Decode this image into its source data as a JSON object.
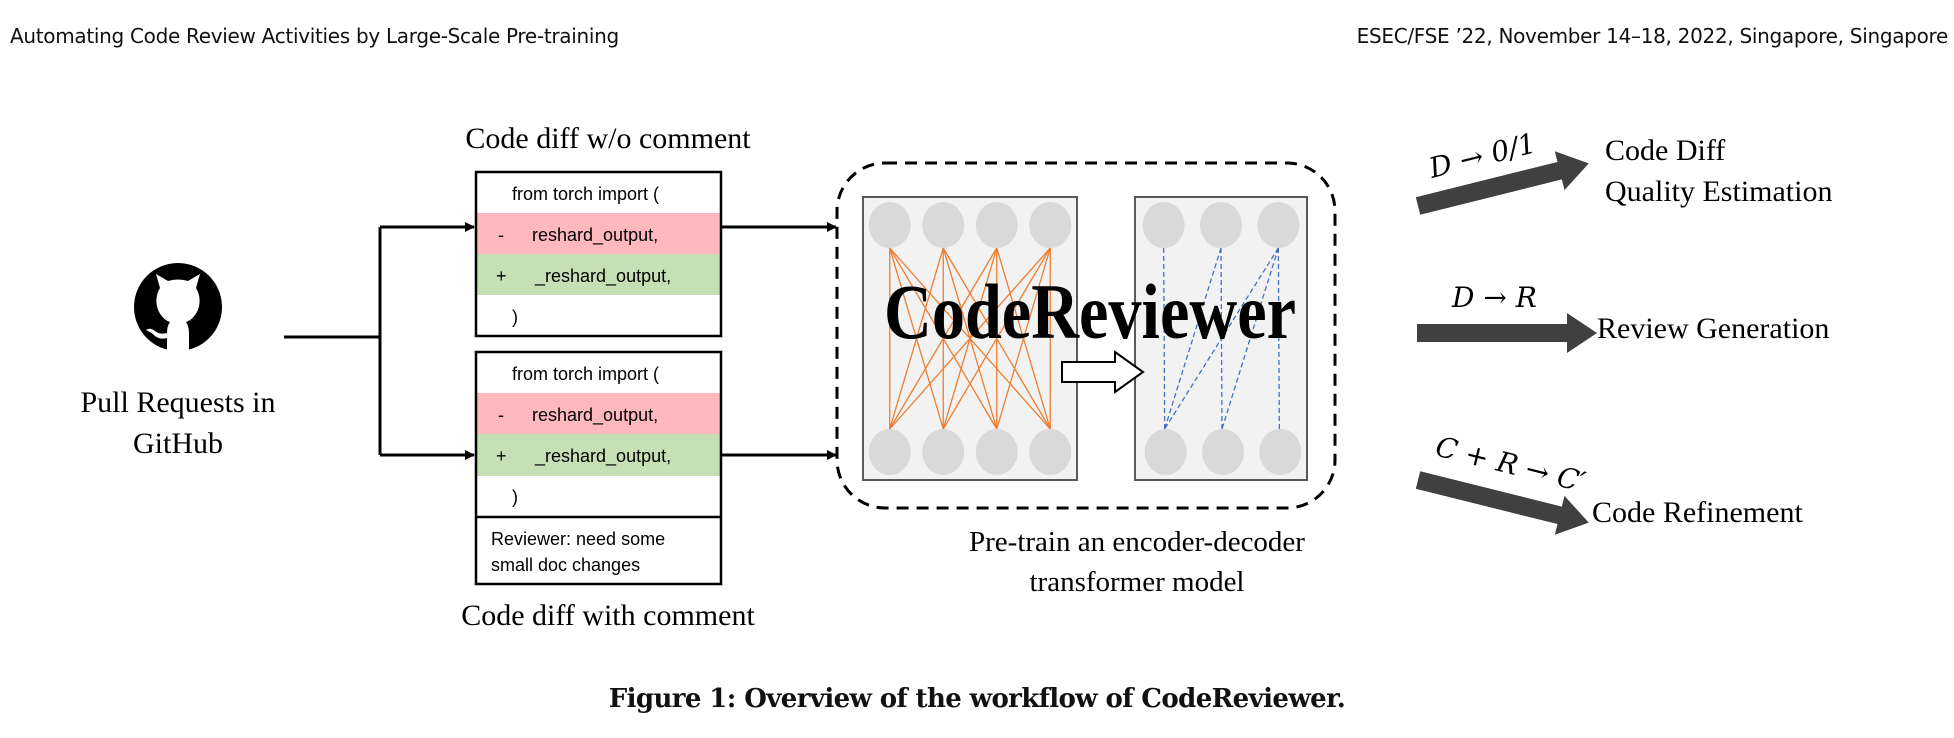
{
  "header": {
    "left": "Automating Code Review Activities by Large-Scale Pre-training",
    "right": "ESEC/FSE ’22, November 14–18, 2022, Singapore, Singapore"
  },
  "source": {
    "icon": "github-icon",
    "label_line1": "Pull Requests in",
    "label_line2": "GitHub"
  },
  "diff_without_comment": {
    "title": "Code diff w/o comment",
    "lines": [
      {
        "marker": "",
        "text": "from torch import (",
        "kind": "context"
      },
      {
        "marker": "-",
        "text": "reshard_output,",
        "kind": "removed"
      },
      {
        "marker": "+",
        "text": "_reshard_output,",
        "kind": "added"
      },
      {
        "marker": "",
        "text": ")",
        "kind": "context"
      }
    ]
  },
  "diff_with_comment": {
    "title": "Code diff with comment",
    "lines": [
      {
        "marker": "",
        "text": "from torch import (",
        "kind": "context"
      },
      {
        "marker": "-",
        "text": "reshard_output,",
        "kind": "removed"
      },
      {
        "marker": "+",
        "text": "_reshard_output,",
        "kind": "added"
      },
      {
        "marker": "",
        "text": ")",
        "kind": "context"
      }
    ],
    "comment_line1": "Reviewer: need some",
    "comment_line2": "small doc changes"
  },
  "model": {
    "name": "CodeReviewer",
    "caption_line1": "Pre-train an encoder-decoder",
    "caption_line2": "transformer model",
    "encoder_nodes_per_layer": 4,
    "decoder_nodes_per_layer": 3
  },
  "tasks": [
    {
      "formula": "D → 0/1",
      "label_line1": "Code Diff",
      "label_line2": "Quality Estimation"
    },
    {
      "formula": "D → R",
      "label_line1": "Review Generation",
      "label_line2": ""
    },
    {
      "formula": "C + R → C′",
      "label_line1": "Code Refinement",
      "label_line2": ""
    }
  ],
  "colors": {
    "removed": "#FFB9BE",
    "added": "#C5E0B4",
    "encoder_edge": "#ED7D31",
    "decoder_edge": "#4472C4",
    "node": "#D9D9D9",
    "panel": "#F2F2F2",
    "task_arrow": "#404040"
  },
  "figure_caption": "Figure 1: Overview of the workflow of CodeReviewer."
}
